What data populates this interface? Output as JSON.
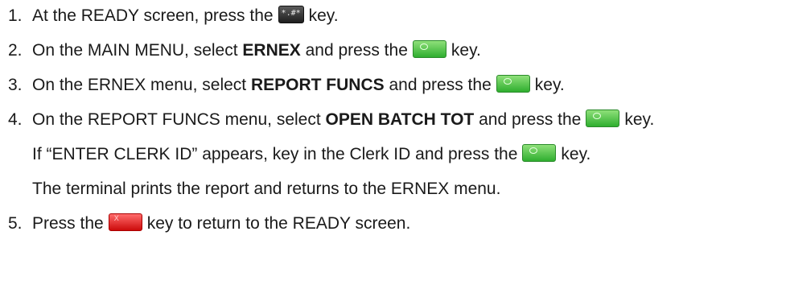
{
  "steps": [
    {
      "number": "1.",
      "before": "At the READY screen, press the",
      "bold": "",
      "middle": "",
      "key_icon": "function-key-icon",
      "after": "key."
    },
    {
      "number": "2.",
      "before": "On the MAIN MENU, select",
      "bold": "ERNEX",
      "middle": "and press the",
      "key_icon": "enter-key-icon",
      "after": "key."
    },
    {
      "number": "3.",
      "before": "On the ERNEX menu, select",
      "bold": "REPORT FUNCS",
      "middle": "and press the",
      "key_icon": "enter-key-icon",
      "after": "key."
    },
    {
      "number": "4.",
      "before": "On the REPORT FUNCS menu, select",
      "bold": "OPEN BATCH TOT",
      "middle": "and press the",
      "key_icon": "enter-key-icon",
      "after": "key."
    }
  ],
  "step4_notes": [
    {
      "before": "If “ENTER CLERK ID” appears, key in the Clerk ID and press the",
      "key_icon": "enter-key-icon",
      "after": "key."
    },
    {
      "text": "The terminal prints the report and returns to the ERNEX menu."
    }
  ],
  "step5": {
    "number": "5.",
    "before": "Press the",
    "key_icon": "cancel-key-icon",
    "after": "key to return to the READY screen."
  },
  "key_glyphs": {
    "function_key": "*.#*",
    "cancel_key": "X"
  },
  "colors": {
    "enter_key": "#3cb83c",
    "cancel_key": "#e01a1a",
    "function_key": "#2b2b2b",
    "text": "#1a1a1a"
  }
}
